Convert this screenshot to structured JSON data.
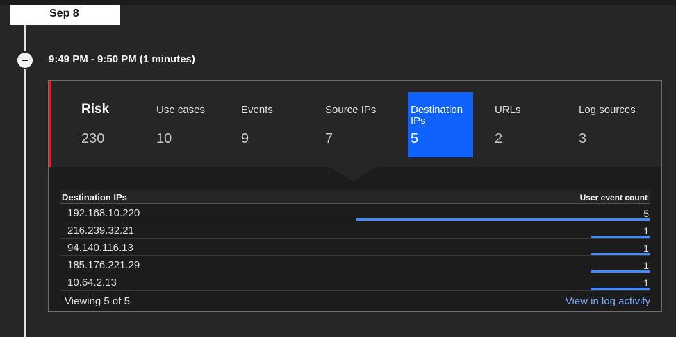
{
  "date_label": "Sep 8",
  "time_range": "9:49 PM - 9:50 PM (1 minutes)",
  "metrics": [
    {
      "label": "Risk",
      "value": "230"
    },
    {
      "label": "Use cases",
      "value": "10"
    },
    {
      "label": "Events",
      "value": "9"
    },
    {
      "label": "Source IPs",
      "value": "7"
    },
    {
      "label": "Destination IPs",
      "value": "5"
    },
    {
      "label": "URLs",
      "value": "2"
    },
    {
      "label": "Log sources",
      "value": "3"
    }
  ],
  "selected_metric": "Destination IPs",
  "colors": {
    "accent": "#0f62fe",
    "risk_bar": "#da1e28",
    "bar": "#4589ff",
    "link": "#78a9ff"
  },
  "table": {
    "headers": [
      "Destination IPs",
      "User event count"
    ],
    "rows": [
      {
        "ip": "192.168.10.220",
        "count": "5",
        "fraction": 1.0
      },
      {
        "ip": "216.239.32.21",
        "count": "1",
        "fraction": 0.2
      },
      {
        "ip": "94.140.116.13",
        "count": "1",
        "fraction": 0.2
      },
      {
        "ip": "185.176.221.29",
        "count": "1",
        "fraction": 0.2
      },
      {
        "ip": "10.64.2.13",
        "count": "1",
        "fraction": 0.2
      }
    ],
    "viewing": "Viewing 5 of 5",
    "link": "View in log activity"
  }
}
